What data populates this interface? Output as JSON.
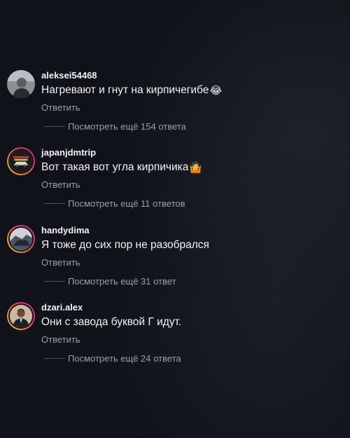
{
  "comments": [
    {
      "username": "aleksei54468",
      "text": "Нагревают и гнут на кирпичегибе",
      "emoji_name": "laughing-face-icon",
      "emoji_glyph": "😂",
      "reply_label": "Ответить",
      "view_more_label": "Посмотреть ещё 154 ответа"
    },
    {
      "username": "japanjdmtrip",
      "text": "Вот такая вот угла кирпичика",
      "emoji_name": "shrugging-person-icon",
      "emoji_glyph": "🤷",
      "reply_label": "Ответить",
      "view_more_label": "Посмотреть ещё 11 ответов"
    },
    {
      "username": "handydima",
      "text": "Я тоже до сих пор не разобрался",
      "reply_label": "Ответить",
      "view_more_label": "Посмотреть ещё 31 ответ"
    },
    {
      "username": "dzari.alex",
      "text": "Они с завода буквой Г идут.",
      "reply_label": "Ответить",
      "view_more_label": "Посмотреть ещё 24 ответа"
    }
  ],
  "colors": {
    "background": "#0f1218",
    "primary_text": "#f1f3f5",
    "secondary_text": "#9aa0a8",
    "story_ring_start": "#f9c43a",
    "story_ring_end": "#c13584"
  }
}
